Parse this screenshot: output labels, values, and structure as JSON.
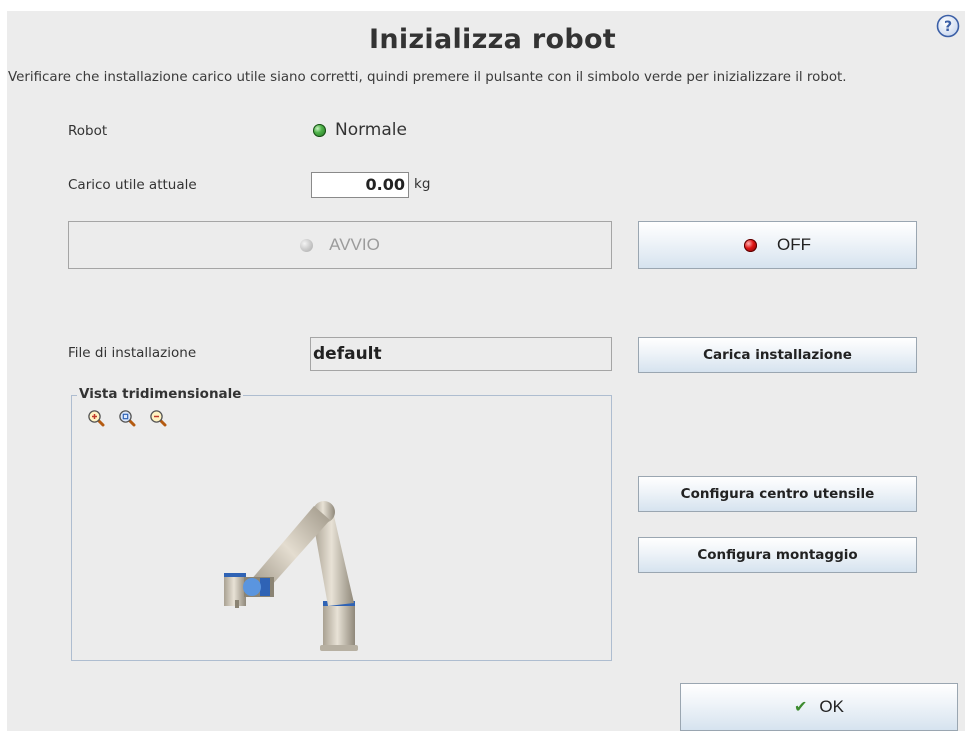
{
  "dialog": {
    "title": "Inizializza robot",
    "instruction": "Verificare che installazione carico utile siano corretti, quindi premere il pulsante con il simbolo verde per inizializzare il robot."
  },
  "robot": {
    "label": "Robot",
    "status": "Normale",
    "status_color": "#3f9d3a"
  },
  "payload": {
    "label": "Carico utile attuale",
    "value": "0.00",
    "unit": "kg"
  },
  "power": {
    "start_label": "AVVIO",
    "start_enabled": false,
    "off_label": "OFF",
    "off_color": "#d41414"
  },
  "installation": {
    "label": "File di installazione",
    "file": "default",
    "load_button": "Carica installazione"
  },
  "view3d": {
    "label": "Vista tridimensionale",
    "tools": [
      "zoom-in-icon",
      "zoom-reset-icon",
      "zoom-out-icon"
    ]
  },
  "config": {
    "tcp_button": "Configura centro utensile",
    "mount_button": "Configura montaggio"
  },
  "footer": {
    "ok_label": "OK"
  },
  "icons": {
    "help": "help-icon",
    "ok": "checkmark-icon"
  }
}
